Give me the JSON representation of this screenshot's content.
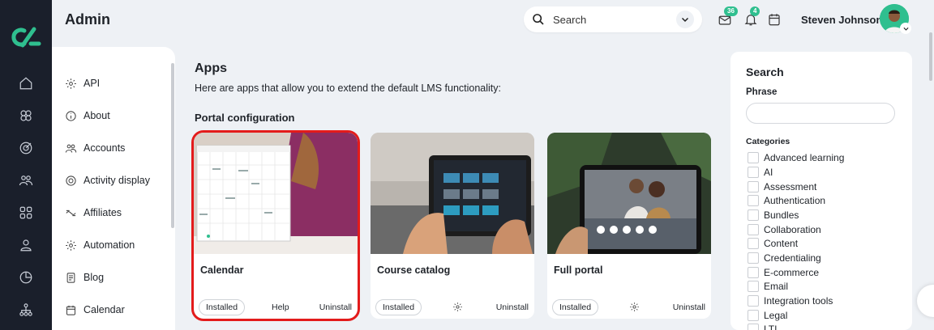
{
  "header": {
    "title": "Admin"
  },
  "search": {
    "placeholder": "Search"
  },
  "notifications": {
    "messages_count": "36",
    "alerts_count": "4"
  },
  "user": {
    "name": "Steven Johnson"
  },
  "rail": {
    "icons": [
      "home-icon",
      "courses-icon",
      "target-icon",
      "users-icon",
      "grid-icon",
      "user-icon",
      "reports-icon",
      "org-chart-icon"
    ]
  },
  "sidebar": {
    "items": [
      {
        "label": "API",
        "icon": "gear-icon"
      },
      {
        "label": "About",
        "icon": "info-icon"
      },
      {
        "label": "Accounts",
        "icon": "accounts-icon"
      },
      {
        "label": "Activity display",
        "icon": "target-icon"
      },
      {
        "label": "Affiliates",
        "icon": "affiliates-icon"
      },
      {
        "label": "Automation",
        "icon": "gear-icon"
      },
      {
        "label": "Blog",
        "icon": "blog-icon"
      },
      {
        "label": "Calendar",
        "icon": "calendar-icon"
      }
    ]
  },
  "main": {
    "title": "Apps",
    "description": "Here are apps that allow you to extend the default LMS functionality:",
    "section": "Portal configuration",
    "cards": [
      {
        "name": "Calendar",
        "status": "Installed",
        "action": "Help",
        "uninstall": "Uninstall"
      },
      {
        "name": "Course catalog",
        "status": "Installed",
        "uninstall": "Uninstall"
      },
      {
        "name": "Full portal",
        "status": "Installed",
        "uninstall": "Uninstall"
      }
    ]
  },
  "filters": {
    "title": "Search",
    "phrase_label": "Phrase",
    "categories_label": "Categories",
    "categories": [
      "Advanced learning",
      "AI",
      "Assessment",
      "Authentication",
      "Bundles",
      "Collaboration",
      "Content",
      "Credentialing",
      "E-commerce",
      "Email",
      "Integration tools",
      "Legal",
      "LTI"
    ]
  },
  "colors": {
    "accent": "#2fbf8f",
    "rail": "#1a1f2b",
    "selection": "#e31b1b"
  }
}
